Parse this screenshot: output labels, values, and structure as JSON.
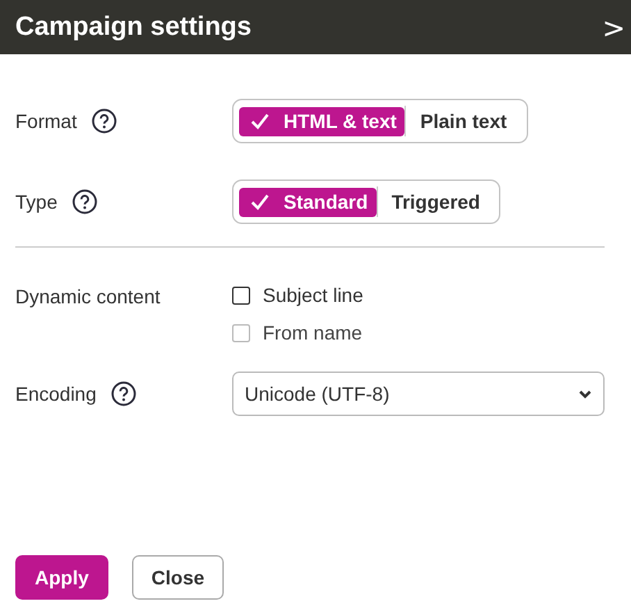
{
  "panel": {
    "title": "Campaign settings",
    "collapse_glyph": ">"
  },
  "settings": [
    {
      "kind": "segmented",
      "label": "Format",
      "help": true,
      "options": [
        {
          "label": "HTML & text",
          "selected": true
        },
        {
          "label": "Plain text",
          "selected": false
        }
      ]
    },
    {
      "kind": "segmented",
      "label": "Type",
      "help": true,
      "options": [
        {
          "label": "Standard",
          "selected": true
        },
        {
          "label": "Triggered",
          "selected": false
        }
      ]
    },
    {
      "kind": "divider"
    },
    {
      "kind": "checkboxes",
      "label": "Dynamic content",
      "help": false,
      "options": [
        {
          "label": "Subject line",
          "checked": false,
          "disabled": false
        },
        {
          "label": "From name",
          "checked": false,
          "disabled": true
        }
      ]
    },
    {
      "kind": "select",
      "label": "Encoding",
      "help": true,
      "value": "Unicode (UTF-8)"
    }
  ],
  "buttons": [
    {
      "label": "Apply",
      "kind": "primary"
    },
    {
      "label": "Close",
      "kind": "secondary"
    }
  ]
}
